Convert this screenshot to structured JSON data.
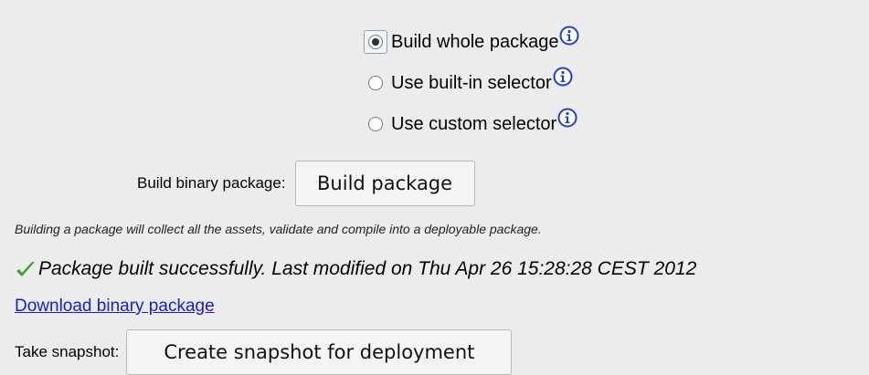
{
  "build_options": {
    "items": [
      {
        "label": "Build whole package",
        "selected": true,
        "icon": "info-icon"
      },
      {
        "label": "Use built-in selector",
        "selected": false,
        "icon": "info-icon"
      },
      {
        "label": "Use custom selector",
        "selected": false,
        "icon": "info-icon"
      }
    ]
  },
  "build": {
    "label": "Build binary package:",
    "button_label": "Build package",
    "hint": "Building a package will collect all the assets, validate and compile into a deployable package."
  },
  "status": {
    "icon": "checkmark-icon",
    "color": "#3aa52a",
    "message": "Package built successfully. Last modified on Thu Apr 26 15:28:28 CEST 2012"
  },
  "download": {
    "link_label": "Download binary package",
    "link_color": "#1a1ad8"
  },
  "snapshot": {
    "label": "Take snapshot:",
    "button_label": "Create snapshot for deployment"
  }
}
